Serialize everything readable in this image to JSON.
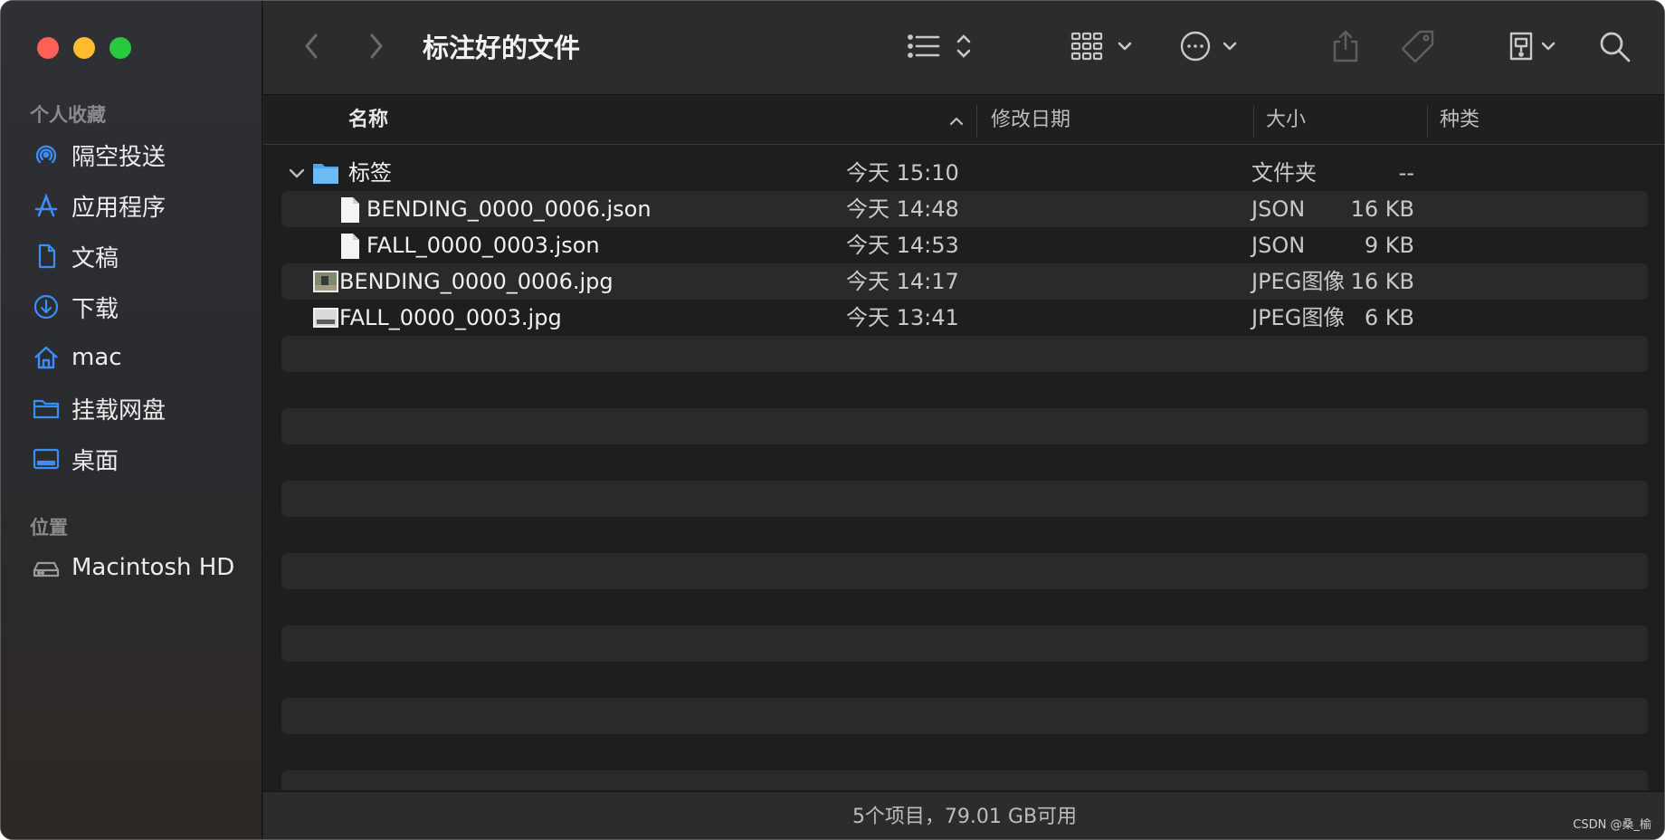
{
  "sidebar": {
    "favorites_title": "个人收藏",
    "favorites": [
      {
        "label": "隔空投送",
        "icon": "airdrop-icon"
      },
      {
        "label": "应用程序",
        "icon": "applications-icon"
      },
      {
        "label": "文稿",
        "icon": "document-icon"
      },
      {
        "label": "下载",
        "icon": "download-icon"
      },
      {
        "label": "mac",
        "icon": "home-icon"
      },
      {
        "label": "挂载网盘",
        "icon": "folder-icon"
      },
      {
        "label": "桌面",
        "icon": "desktop-icon"
      }
    ],
    "locations_title": "位置",
    "locations": [
      {
        "label": "Macintosh HD",
        "icon": "disk-icon"
      }
    ]
  },
  "toolbar": {
    "title": "标注好的文件"
  },
  "columns": {
    "name": "名称",
    "date": "修改日期",
    "size": "大小",
    "kind": "种类"
  },
  "files": [
    {
      "name": "标签",
      "date": "今天 15:10",
      "size": "--",
      "kind": "文件夹",
      "type": "folder",
      "indent": 0,
      "expanded": true
    },
    {
      "name": "BENDING_0000_0006.json",
      "date": "今天 14:48",
      "size": "16 KB",
      "kind": "JSON",
      "type": "file",
      "indent": 1
    },
    {
      "name": "FALL_0000_0003.json",
      "date": "今天 14:53",
      "size": "9 KB",
      "kind": "JSON",
      "type": "file",
      "indent": 1
    },
    {
      "name": "BENDING_0000_0006.jpg",
      "date": "今天 14:17",
      "size": "16 KB",
      "kind": "JPEG图像",
      "type": "image",
      "indent": 0
    },
    {
      "name": "FALL_0000_0003.jpg",
      "date": "今天 13:41",
      "size": "6 KB",
      "kind": "JPEG图像",
      "type": "image",
      "indent": 0
    }
  ],
  "status": {
    "text": "5个项目，79.01 GB可用"
  },
  "watermark": "CSDN @桑_榆",
  "colors": {
    "accent": "#1e90ff",
    "folder": "#5fb0f2",
    "close": "#fe5f57",
    "minimize": "#febc2e",
    "zoom": "#28c840"
  }
}
